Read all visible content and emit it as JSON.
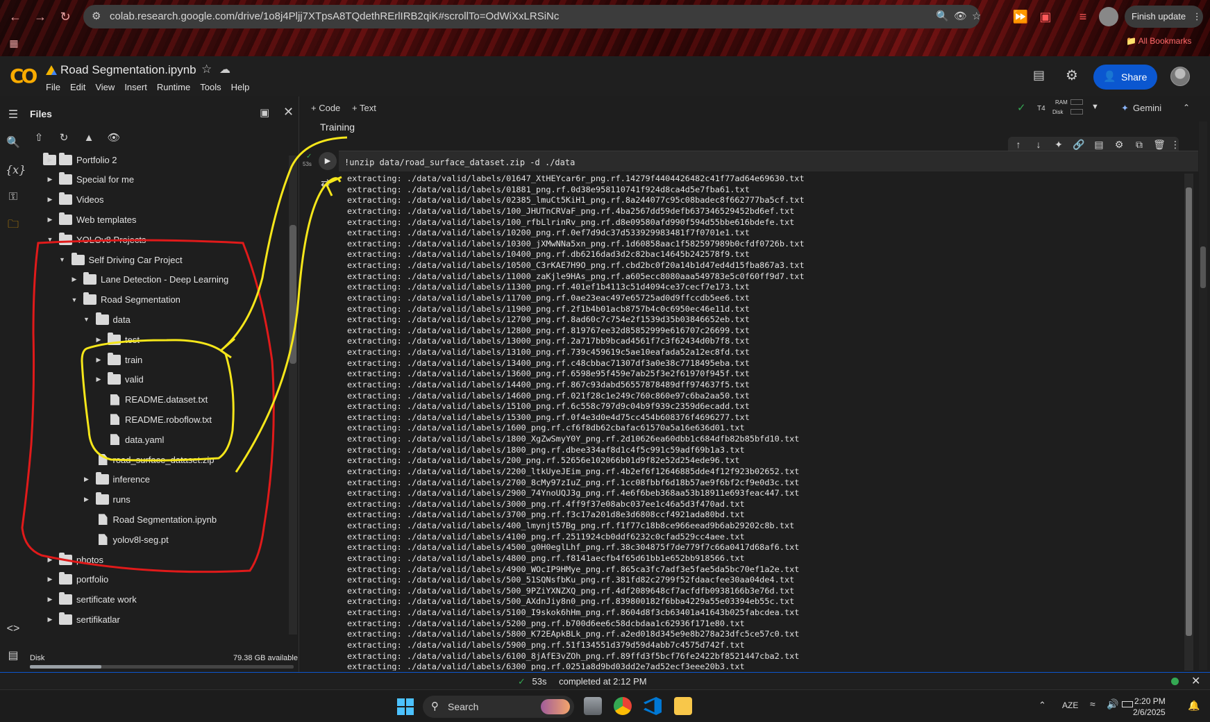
{
  "browser": {
    "url": "colab.research.google.com/drive/1o8j4Pljj7XTpsA8TQdethRErlIRB2qiK#scrollTo=OdWiXxLRSiNc",
    "finish_update": "Finish update",
    "all_bookmarks": "All Bookmarks"
  },
  "colab": {
    "logo": "CO",
    "title": "Road Segmentation.ipynb",
    "menu": [
      "File",
      "Edit",
      "View",
      "Insert",
      "Runtime",
      "Tools",
      "Help"
    ],
    "share": "Share"
  },
  "files_panel": {
    "title": "Files",
    "tree": [
      {
        "label": "Portfolio 2",
        "type": "folder",
        "depth": 1,
        "state": "collapsed"
      },
      {
        "label": "Special for me",
        "type": "folder",
        "depth": 1,
        "state": "collapsed"
      },
      {
        "label": "Videos",
        "type": "folder",
        "depth": 1,
        "state": "collapsed"
      },
      {
        "label": "Web templates",
        "type": "folder",
        "depth": 1,
        "state": "collapsed"
      },
      {
        "label": "YOLOv8 Projects",
        "type": "folder",
        "depth": 1,
        "state": "expanded"
      },
      {
        "label": "Self Driving Car Project",
        "type": "folder",
        "depth": 2,
        "state": "expanded"
      },
      {
        "label": "Lane Detection - Deep Learning",
        "type": "folder",
        "depth": 3,
        "state": "collapsed"
      },
      {
        "label": "Road Segmentation",
        "type": "folder",
        "depth": 3,
        "state": "expanded"
      },
      {
        "label": "data",
        "type": "folder",
        "depth": 4,
        "state": "expanded"
      },
      {
        "label": "test",
        "type": "folder",
        "depth": 5,
        "state": "collapsed"
      },
      {
        "label": "train",
        "type": "folder",
        "depth": 5,
        "state": "collapsed"
      },
      {
        "label": "valid",
        "type": "folder",
        "depth": 5,
        "state": "collapsed"
      },
      {
        "label": "README.dataset.txt",
        "type": "file",
        "depth": 5
      },
      {
        "label": "README.roboflow.txt",
        "type": "file",
        "depth": 5
      },
      {
        "label": "data.yaml",
        "type": "file",
        "depth": 5
      },
      {
        "label": "road_surface_dataset.zip",
        "type": "file",
        "depth": 4
      },
      {
        "label": "inference",
        "type": "folder",
        "depth": 4,
        "state": "collapsed"
      },
      {
        "label": "runs",
        "type": "folder",
        "depth": 4,
        "state": "collapsed"
      },
      {
        "label": "Road Segmentation.ipynb",
        "type": "file",
        "depth": 4
      },
      {
        "label": "yolov8l-seg.pt",
        "type": "file",
        "depth": 4
      },
      {
        "label": "photos",
        "type": "folder",
        "depth": 1,
        "state": "collapsed"
      },
      {
        "label": "portfolio",
        "type": "folder",
        "depth": 1,
        "state": "collapsed"
      },
      {
        "label": "sertificate work",
        "type": "folder",
        "depth": 1,
        "state": "collapsed"
      },
      {
        "label": "sertifikatlar",
        "type": "folder",
        "depth": 1,
        "state": "collapsed"
      }
    ],
    "disk_label": "Disk",
    "disk_available": "79.38 GB available",
    "disk_used_fraction": 0.27
  },
  "notebook": {
    "add_code": "+ Code",
    "add_text": "+ Text",
    "runtime": "T4",
    "ram_label": "RAM",
    "disk_label": "Disk",
    "gemini": "Gemini",
    "section_heading": "Training",
    "exec_time": "53s",
    "code": "!unzip data/road_surface_dataset.zip -d ./data",
    "output_lines": [
      "extracting: ./data/valid/labels/01647_XtHEYcar6r_png.rf.14279f4404426482c41f77ad64e69630.txt",
      "extracting: ./data/valid/labels/01881_png.rf.0d38e958110741f924d8ca4d5e7fba61.txt",
      "extracting: ./data/valid/labels/02385_lmuCt5KiH1_png.rf.8a244077c95c08badec8f662777ba5cf.txt",
      "extracting: ./data/valid/labels/100_JHUTnCRVaF_png.rf.4ba2567dd59defb637346529452bd6ef.txt",
      "extracting: ./data/valid/labels/100_rfbLlrinRv_png.rf.d8e09580afd990f594d55bbe616bdefe.txt",
      "extracting: ./data/valid/labels/10200_png.rf.0ef7d9dc37d533929983481f7f0701e1.txt",
      "extracting: ./data/valid/labels/10300_jXMwNNa5xn_png.rf.1d60858aac1f582597989b0cfdf0726b.txt",
      "extracting: ./data/valid/labels/10400_png.rf.db6216dad3d2c82bac14645b242578f9.txt",
      "extracting: ./data/valid/labels/10500_C3rKAE7H9O_png.rf.cbd2bc0f20a14b1d47ed4d15fba867a3.txt",
      "extracting: ./data/valid/labels/11000_zaKjle9HAs_png.rf.a605ecc8080aaa549783e5c0f60ff9d7.txt",
      "extracting: ./data/valid/labels/11300_png.rf.401ef1b4113c51d4094ce37cecf7e173.txt",
      "extracting: ./data/valid/labels/11700_png.rf.0ae23eac497e65725ad0d9ffccdb5ee6.txt",
      "extracting: ./data/valid/labels/11900_png.rf.2f1b4b01acb8757b4c0c6950ec46e11d.txt",
      "extracting: ./data/valid/labels/12700_png.rf.8ad60c7c754e2f1539d35b03846652eb.txt",
      "extracting: ./data/valid/labels/12800_png.rf.819767ee32d85852999e616707c26699.txt",
      "extracting: ./data/valid/labels/13000_png.rf.2a717bb9bcad4561f7c3f62434d0b7f8.txt",
      "extracting: ./data/valid/labels/13100_png.rf.739c459619c5ae10eafada52a12ec8fd.txt",
      "extracting: ./data/valid/labels/13400_png.rf.c48cbbac71307df3a0e38c7718495eba.txt",
      "extracting: ./data/valid/labels/13600_png.rf.6598e95f459e7ab25f3e2f61970f945f.txt",
      "extracting: ./data/valid/labels/14400_png.rf.867c93dabd56557878489dff974637f5.txt",
      "extracting: ./data/valid/labels/14600_png.rf.021f28c1e249c760c860e97c6ba2aa50.txt",
      "extracting: ./data/valid/labels/15100_png.rf.6c558c797d9c04b9f939c2359d6ecadd.txt",
      "extracting: ./data/valid/labels/15300_png.rf.0f4e3d0e4d75cc454b608376f4696277.txt",
      "extracting: ./data/valid/labels/1600_png.rf.cf6f8db62cbafac61570a5a16e636d01.txt",
      "extracting: ./data/valid/labels/1800_XgZwSmyY0Y_png.rf.2d10626ea60dbb1c684dfb82b85bfd10.txt",
      "extracting: ./data/valid/labels/1800_png.rf.dbee334af8d1c4f5c991c59adf69b1a3.txt",
      "extracting: ./data/valid/labels/200_png.rf.52656e102066b01d9f82e52d254ede96.txt",
      "extracting: ./data/valid/labels/2200_ltkUyeJEim_png.rf.4b2ef6f12646885dde4f12f923b02652.txt",
      "extracting: ./data/valid/labels/2700_8cMy97zIuZ_png.rf.1cc08fbbf6d18b57ae9f6bf2cf9e0d3c.txt",
      "extracting: ./data/valid/labels/2900_74YnoUQJ3g_png.rf.4e6f6beb368aa53b18911e693feac447.txt",
      "extracting: ./data/valid/labels/3000_png.rf.4ff9f37e08abc037ee1c46a5d3f470ad.txt",
      "extracting: ./data/valid/labels/3700_png.rf.f3c17a201d8e3d6808ccf4921ada80bd.txt",
      "extracting: ./data/valid/labels/400_lmynjt57Bg_png.rf.f1f77c18b8ce966eead9b6ab29202c8b.txt",
      "extracting: ./data/valid/labels/4100_png.rf.2511924cb0ddf6232c0cfad529cc4aee.txt",
      "extracting: ./data/valid/labels/4500_g0H0eglLhf_png.rf.38c304875f7de779f7c66a0417d68af6.txt",
      "extracting: ./data/valid/labels/4800_png.rf.f8141aecfb4f65d61bb1e652bb918566.txt",
      "extracting: ./data/valid/labels/4900_WOcIP9HMye_png.rf.865ca3fc7adf3e5fae5da5bc70ef1a2e.txt",
      "extracting: ./data/valid/labels/500_51SQNsfbKu_png.rf.381fd82c2799f52fdaacfee30aa04de4.txt",
      "extracting: ./data/valid/labels/500_9PZiYXNZXQ_png.rf.4df2089648cf7acfdfb0938166b3e76d.txt",
      "extracting: ./data/valid/labels/500_AXdnJiy8n0_png.rf.839800182f6bba4229a55e03394eb55c.txt",
      "extracting: ./data/valid/labels/5100_I9skok6hHm_png.rf.8604d8f3cb63401a41643b025fabcdea.txt",
      "extracting: ./data/valid/labels/5200_png.rf.b700d6ee6c58dcbdaa1c62936f171e80.txt",
      "extracting: ./data/valid/labels/5800_K72EApkBLk_png.rf.a2ed018d345e9e8b278a23dfc5ce57c0.txt",
      "extracting: ./data/valid/labels/5900_png.rf.51f134551d379d59d4abb7c4575d742f.txt",
      "extracting: ./data/valid/labels/6100_8jAfE3vZOh_png.rf.89ffd3f5bcf76fe2422bf8521447cba2.txt",
      "extracting: ./data/valid/labels/6300_png.rf.0251a8d9bd03dd2e7ad52ecf3eee20b3.txt"
    ]
  },
  "status": {
    "duration": "53s",
    "completed": "completed at 2:12 PM"
  },
  "taskbar": {
    "search": "Search",
    "language": "AZE",
    "time": "2:20 PM",
    "date": "2/6/2025"
  },
  "colors": {
    "annotation_red": "#e01a1a",
    "annotation_yellow": "#f5e61a",
    "share_blue": "#0b57d0",
    "logo_orange": "#f9ab00",
    "check_green": "#34a853"
  }
}
